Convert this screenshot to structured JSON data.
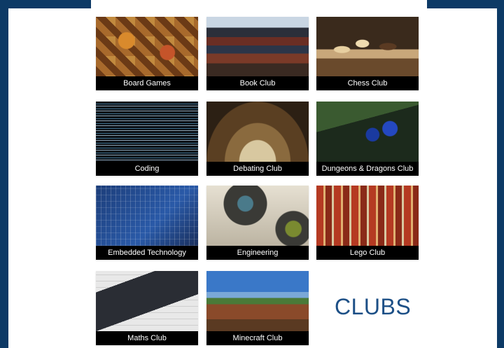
{
  "page": {
    "heading": "CLUBS"
  },
  "clubs": [
    {
      "label": "Board Games",
      "icon": "board-games-photo"
    },
    {
      "label": "Book Club",
      "icon": "books-photo"
    },
    {
      "label": "Chess Club",
      "icon": "chess-photo"
    },
    {
      "label": "Coding",
      "icon": "code-photo"
    },
    {
      "label": "Debating Club",
      "icon": "parliament-photo"
    },
    {
      "label": "Dungeons & Dragons Club",
      "icon": "dice-photo"
    },
    {
      "label": "Embedded Technology",
      "icon": "circuit-board-photo"
    },
    {
      "label": "Engineering",
      "icon": "gears-photo"
    },
    {
      "label": "Lego Club",
      "icon": "lego-city-photo"
    },
    {
      "label": "Maths Club",
      "icon": "calculator-photo"
    },
    {
      "label": "Minecraft Club",
      "icon": "minecraft-landscape-photo"
    }
  ],
  "colors": {
    "background": "#0d3a66",
    "heading": "#1c4f86",
    "caption_bg": "#000000"
  }
}
